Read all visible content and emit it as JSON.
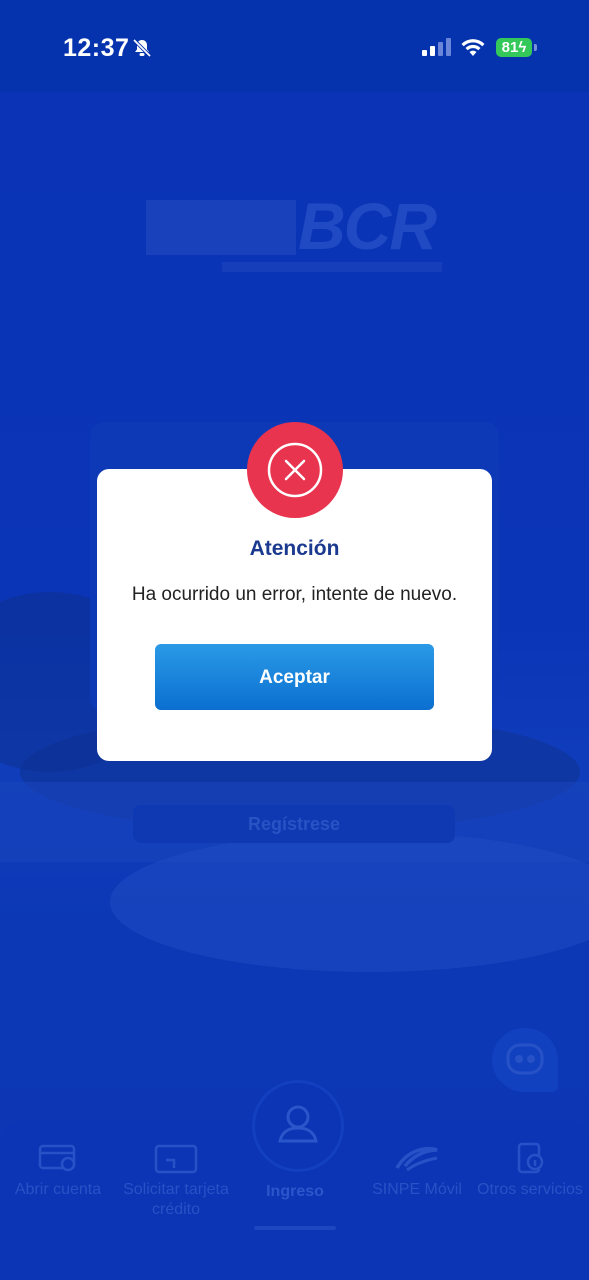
{
  "status_bar": {
    "time": "12:37",
    "battery": "81"
  },
  "background": {
    "logo": "BCR",
    "register_label": "Regístrese"
  },
  "bottom_nav": {
    "items": [
      {
        "label": "Abrir cuenta",
        "icon": "open-account-icon"
      },
      {
        "label": "Solicitar tarjeta crédito",
        "icon": "credit-card-icon"
      },
      {
        "label": "Ingreso",
        "icon": "user-icon"
      },
      {
        "label": "SINPE Móvil",
        "icon": "sinpe-icon"
      },
      {
        "label": "Otros servicios",
        "icon": "other-services-icon"
      }
    ]
  },
  "dialog": {
    "title": "Atención",
    "message": "Ha ocurrido un error, intente de nuevo.",
    "button_label": "Aceptar"
  },
  "colors": {
    "header": "#0533ad",
    "background": "#0a34b8",
    "error": "#e8344e",
    "title": "#1b3a8f",
    "button": "#0b6fd0"
  }
}
